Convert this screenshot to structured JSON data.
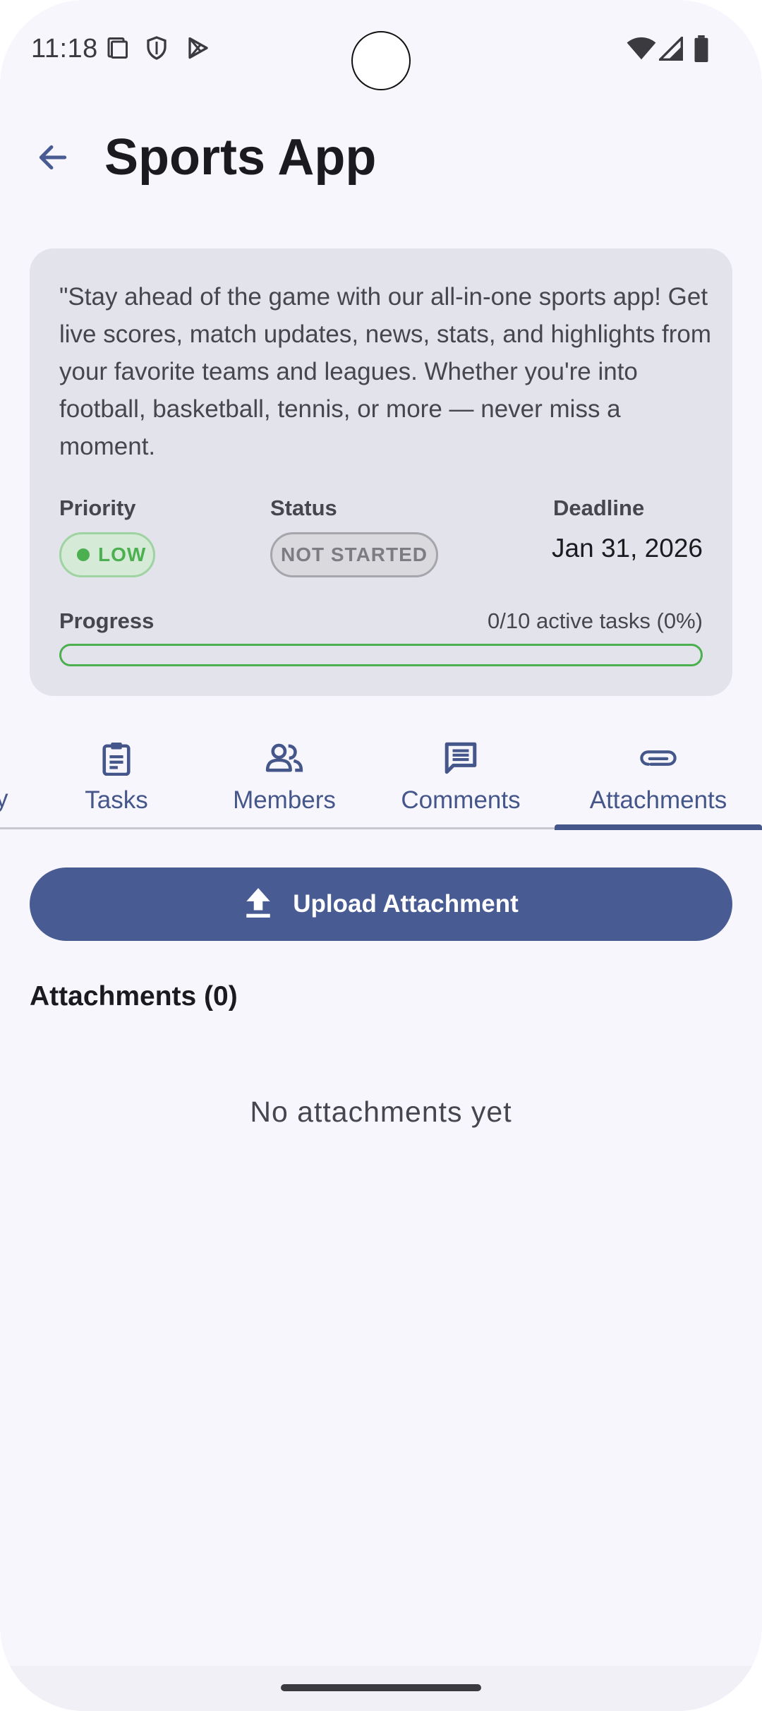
{
  "status_bar": {
    "time": "11:18"
  },
  "app_bar": {
    "title": "Sports App"
  },
  "project": {
    "description": "\"Stay ahead of the game with our all-in-one sports app! Get live scores, match updates, news, stats, and highlights from your favorite teams and leagues. Whether you're into football, basketball, tennis, or more — never miss a moment.",
    "priority_label": "Priority",
    "priority_value": "LOW",
    "status_label": "Status",
    "status_value": "NOT STARTED",
    "deadline_label": "Deadline",
    "deadline_value": "Jan 31, 2026",
    "progress_label": "Progress",
    "progress_text": "0/10 active tasks (0%)",
    "progress_fraction": 0
  },
  "tabs": {
    "partial_label": "y",
    "items": [
      {
        "label": "Tasks",
        "icon": "clipboard-icon"
      },
      {
        "label": "Members",
        "icon": "people-icon"
      },
      {
        "label": "Comments",
        "icon": "comment-icon"
      },
      {
        "label": "Attachments",
        "icon": "paperclip-icon",
        "selected": true
      }
    ]
  },
  "attachments": {
    "upload_label": "Upload Attachment",
    "section_title": "Attachments (0)",
    "empty_text": "No attachments yet"
  },
  "colors": {
    "primary": "#485b92",
    "low_priority": "#4caf50",
    "card_bg": "#e3e3eb",
    "screen_bg": "#f7f6fc"
  }
}
